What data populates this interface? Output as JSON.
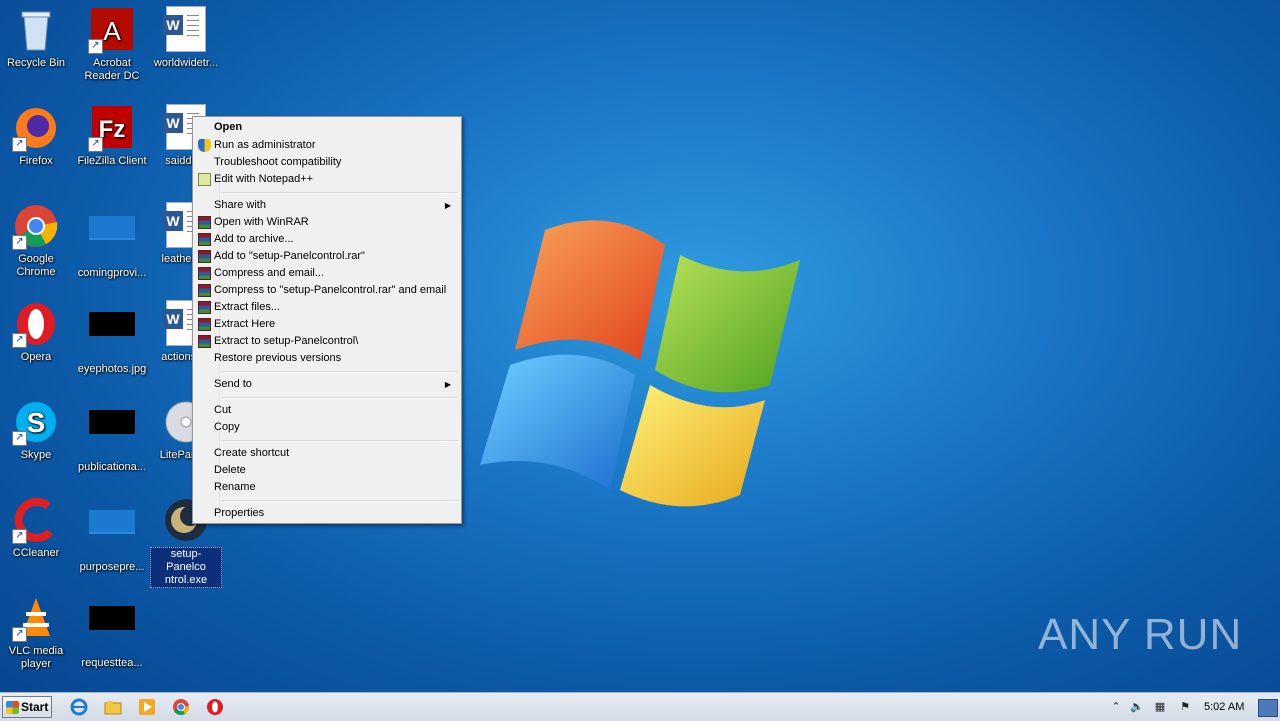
{
  "desktop": {
    "icons": [
      {
        "label": "Recycle Bin",
        "icon": "recycle-bin-icon"
      },
      {
        "label": "Acrobat Reader DC",
        "icon": "acrobat-icon"
      },
      {
        "label": "worldwidetr...",
        "icon": "word-document-icon"
      },
      {
        "label": "Firefox",
        "icon": "firefox-icon"
      },
      {
        "label": "FileZilla Client",
        "icon": "filezilla-icon"
      },
      {
        "label": "saidde...",
        "icon": "word-document-icon"
      },
      {
        "label": "Google Chrome",
        "icon": "chrome-icon"
      },
      {
        "label": "comingprovi...",
        "icon": "file-icon"
      },
      {
        "label": "leathern...",
        "icon": "word-document-icon"
      },
      {
        "label": "Opera",
        "icon": "opera-icon"
      },
      {
        "label": "eyephotos.jpg",
        "icon": "image-file-icon"
      },
      {
        "label": "actionsc...",
        "icon": "word-document-icon"
      },
      {
        "label": "Skype",
        "icon": "skype-icon"
      },
      {
        "label": "publicationa...",
        "icon": "image-file-icon"
      },
      {
        "label": "LitePane...",
        "icon": "disc-icon"
      },
      {
        "label": "CCleaner",
        "icon": "ccleaner-icon"
      },
      {
        "label": "purposepre...",
        "icon": "file-icon"
      },
      {
        "label": "setup-Panelcontrol.exe",
        "label_line1": "setup-Panelco",
        "label_line2": "ntrol.exe",
        "icon": "setup-exe-icon",
        "selected": true
      },
      {
        "label": "VLC media player",
        "icon": "vlc-icon"
      },
      {
        "label": "requesttea...",
        "icon": "image-file-icon"
      }
    ]
  },
  "context_menu": {
    "items": [
      {
        "label": "Open",
        "bold": true
      },
      {
        "label": "Run as administrator",
        "icon": "uac-shield-icon"
      },
      {
        "label": "Troubleshoot compatibility"
      },
      {
        "label": "Edit with Notepad++",
        "icon": "notepad-plus-plus-icon"
      },
      {
        "label": "Share with",
        "submenu": true
      },
      {
        "label": "Open with WinRAR",
        "icon": "winrar-icon"
      },
      {
        "label": "Add to archive...",
        "icon": "winrar-icon"
      },
      {
        "label": "Add to \"setup-Panelcontrol.rar\"",
        "icon": "winrar-icon"
      },
      {
        "label": "Compress and email...",
        "icon": "winrar-icon"
      },
      {
        "label": "Compress to \"setup-Panelcontrol.rar\" and email",
        "icon": "winrar-icon"
      },
      {
        "label": "Extract files...",
        "icon": "winrar-icon"
      },
      {
        "label": "Extract Here",
        "icon": "winrar-icon"
      },
      {
        "label": "Extract to setup-Panelcontrol\\",
        "icon": "winrar-icon"
      },
      {
        "label": "Restore previous versions"
      },
      {
        "label": "Send to",
        "submenu": true
      },
      {
        "label": "Cut"
      },
      {
        "label": "Copy"
      },
      {
        "label": "Create shortcut"
      },
      {
        "label": "Delete"
      },
      {
        "label": "Rename"
      },
      {
        "label": "Properties"
      }
    ]
  },
  "taskbar": {
    "start_label": "Start",
    "pinned": [
      "internet-explorer-icon",
      "file-explorer-icon",
      "media-player-icon",
      "chrome-icon",
      "opera-icon"
    ],
    "tray": [
      "show-hidden-icons-icon",
      "volume-icon",
      "network-icon",
      "action-center-flag-icon"
    ],
    "clock": "5:02 AM"
  },
  "watermark": "ANY RUN"
}
